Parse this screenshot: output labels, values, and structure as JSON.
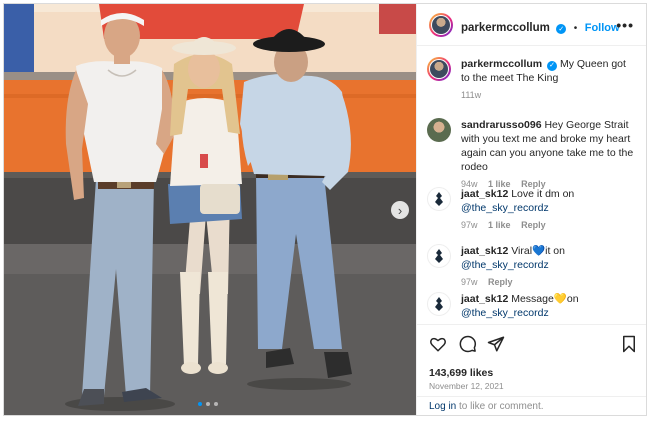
{
  "post": {
    "username": "parkermccollum",
    "follow_label": "Follow",
    "separator": "•",
    "more_icon": "more-horizontal-icon",
    "caption": "My Queen got to the meet The King",
    "caption_age": "111w",
    "likes": "143,699 likes",
    "date": "November 12, 2021",
    "carousel_pages": 3,
    "carousel_active": 1
  },
  "comments": [
    {
      "username": "sandrarusso096",
      "text": "Hey George Strait with you text me and broke my heart again can you anyone take me to the rodeo",
      "age": "94w",
      "likes": "1 like",
      "reply": "Reply"
    },
    {
      "username": "jaat_sk12",
      "text_before": "Love it dm on",
      "emoji": "",
      "text_after": "",
      "mention": "@the_sky_recordz",
      "age": "97w",
      "likes": "1 like",
      "reply": "Reply"
    },
    {
      "username": "jaat_sk12",
      "text_before": "Viral",
      "emoji": "💙",
      "text_after": "it on",
      "mention": "@the_sky_recordz",
      "age": "97w",
      "likes": "",
      "reply": "Reply"
    },
    {
      "username": "jaat_sk12",
      "text_before": "Message",
      "emoji": "💛",
      "text_after": "on",
      "mention": "@the_sky_recordz",
      "age": "",
      "likes": "",
      "reply": ""
    }
  ],
  "actions": {
    "like_icon": "heart-icon",
    "comment_icon": "comment-icon",
    "share_icon": "share-icon",
    "save_icon": "bookmark-icon"
  },
  "login_prompt": {
    "link": "Log in",
    "text": "to like or comment."
  },
  "colors": {
    "accent": "#0095f6",
    "mention": "#00376b",
    "muted": "#8e8e8e",
    "banner_orange": "#e8732e"
  }
}
